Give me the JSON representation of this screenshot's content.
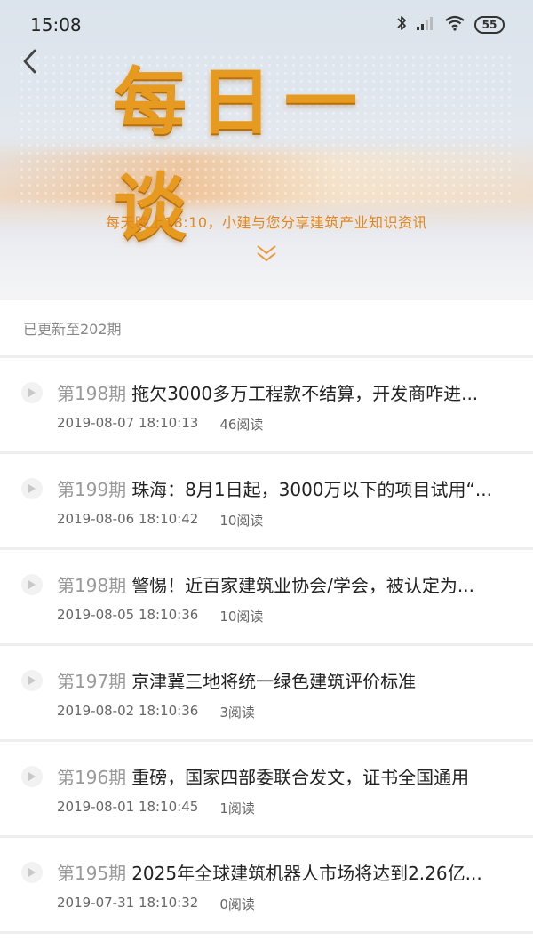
{
  "status_bar": {
    "time": "15:08",
    "battery": "55",
    "icons": [
      "bluetooth-icon",
      "signal-icon",
      "wifi-icon",
      "battery-icon"
    ]
  },
  "header": {
    "logo_text": "每日一谈",
    "tagline": "每天晚上18:10，小建与您分享建筑产业知识资讯"
  },
  "update_status": "已更新至202期",
  "items": [
    {
      "issue": "第198期",
      "title": "拖欠3000多万工程款不结算，开发商咋进...",
      "date": "2019-08-07 18:10:13",
      "reads": "46阅读"
    },
    {
      "issue": "第199期",
      "title": "珠海：8月1日起，3000万以下的项目试用“...",
      "date": "2019-08-06 18:10:42",
      "reads": "10阅读"
    },
    {
      "issue": "第198期",
      "title": "警惕！近百家建筑业协会/学会，被认定为...",
      "date": "2019-08-05 18:10:36",
      "reads": "10阅读"
    },
    {
      "issue": "第197期",
      "title": "京津冀三地将统一绿色建筑评价标准",
      "date": "2019-08-02 18:10:36",
      "reads": "3阅读"
    },
    {
      "issue": "第196期",
      "title": "重磅，国家四部委联合发文，证书全国通用",
      "date": "2019-08-01 18:10:45",
      "reads": "1阅读"
    },
    {
      "issue": "第195期",
      "title": "2025年全球建筑机器人市场将达到2.26亿...",
      "date": "2019-07-31 18:10:32",
      "reads": "0阅读"
    }
  ],
  "colors": {
    "accent": "#e2871c",
    "logo": "#e79a20"
  }
}
